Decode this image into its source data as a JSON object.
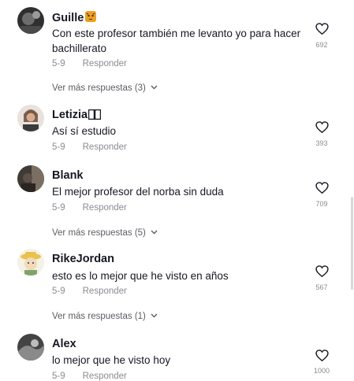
{
  "comments": [
    {
      "name": "Guille",
      "text": "Con este profesor también me levanto yo para hacer bachillerato",
      "date": "5-9",
      "reply": "Responder",
      "likes": "692",
      "more": "Ver más respuestas (3)"
    },
    {
      "name": "Letizia",
      "text": "Así sí estudio",
      "date": "5-9",
      "reply": "Responder",
      "likes": "393"
    },
    {
      "name": "Blank",
      "text": "El mejor profesor del norba sin duda",
      "date": "5-9",
      "reply": "Responder",
      "likes": "709",
      "more": "Ver más respuestas (5)"
    },
    {
      "name": "RikeJordan",
      "text": "esto es lo mejor que he visto en años",
      "date": "5-9",
      "reply": "Responder",
      "likes": "567",
      "more": "Ver más respuestas (1)"
    },
    {
      "name": "Alex",
      "text": "lo mejor que he visto hoy",
      "date": "5-9",
      "reply": "Responder",
      "likes": "1000"
    }
  ],
  "icons": {
    "like": "heart-outline-icon",
    "expand": "chevron-down-icon",
    "badge": "tiger-emoji",
    "unknown": "missing-glyph-boxes"
  },
  "colors": {
    "text": "#161823",
    "meta": "#8a8b91",
    "badge": "#f0a020"
  }
}
